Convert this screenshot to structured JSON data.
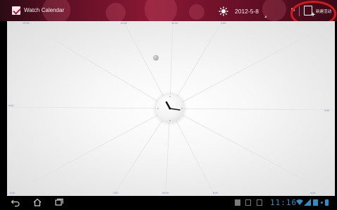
{
  "app": {
    "title": "Watch Calendar"
  },
  "header": {
    "date": "2012-5-8",
    "month_label": "M",
    "new_event_label": "新建活动"
  },
  "icons": {
    "app": "calendar-check-icon",
    "weather": "sun-icon",
    "new_event": "new-event-icon",
    "nav_back": "back-icon",
    "nav_home": "home-icon",
    "nav_recent": "recent-apps-icon"
  },
  "calendar": {
    "hour_labels": {
      "top": [
        "10:00",
        "11:00",
        "12:00",
        "1:00"
      ],
      "left": "9:00",
      "right": "3:00",
      "bottom": [
        "6:00",
        "7:00",
        "00:00",
        "5:00",
        "4:00"
      ]
    }
  },
  "status_bar": {
    "time": "11:16"
  },
  "colors": {
    "action_bar": "#8a1834",
    "highlight": "#d4191f",
    "hour_label": "#7b8bb8",
    "status_accent": "#2e8fc4"
  }
}
